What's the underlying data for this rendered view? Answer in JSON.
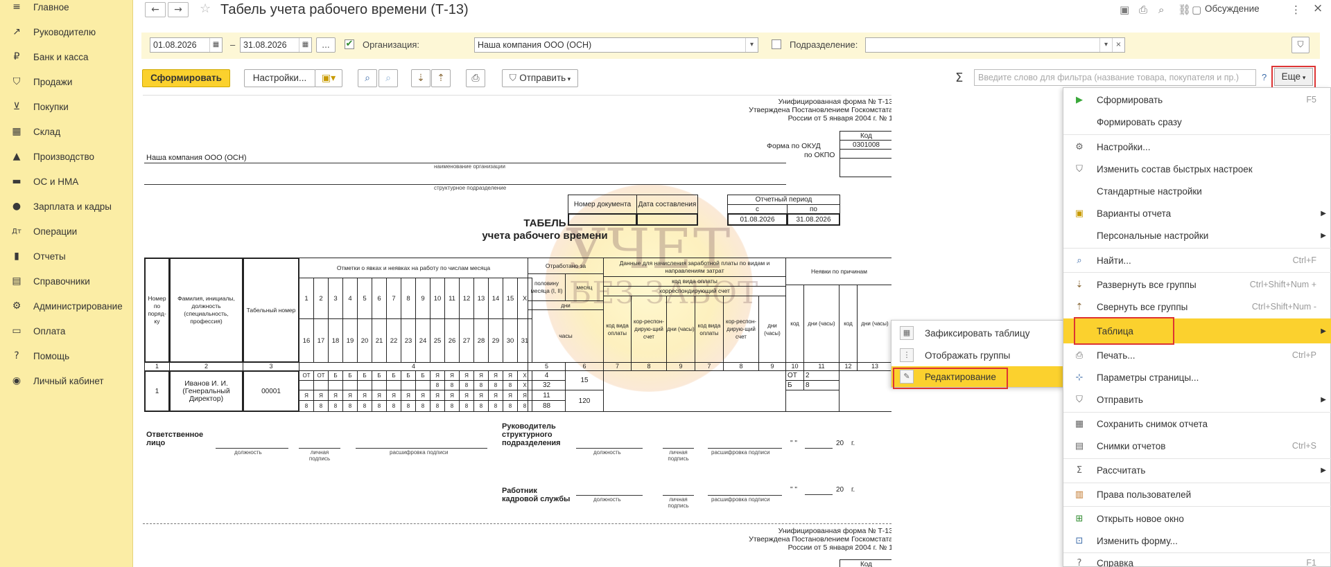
{
  "sidebar": {
    "items": [
      {
        "icon": "≡",
        "label": "Главное"
      },
      {
        "icon": "↗",
        "label": "Руководителю"
      },
      {
        "icon": "₽",
        "label": "Банк и касса"
      },
      {
        "icon": "⛉",
        "label": "Продажи"
      },
      {
        "icon": "⊻",
        "label": "Покупки"
      },
      {
        "icon": "▦",
        "label": "Склад"
      },
      {
        "icon": "▲",
        "label": "Производство"
      },
      {
        "icon": "▬",
        "label": "ОС и НМА"
      },
      {
        "icon": "●",
        "label": "Зарплата и кадры"
      },
      {
        "icon": "Дт",
        "label": "Операции"
      },
      {
        "icon": "▮",
        "label": "Отчеты"
      },
      {
        "icon": "▤",
        "label": "Справочники"
      },
      {
        "icon": "⚙",
        "label": "Администрирование"
      },
      {
        "icon": "▭",
        "label": "Оплата"
      },
      {
        "icon": "?",
        "label": "Помощь"
      },
      {
        "icon": "◉",
        "label": "Личный кабинет"
      }
    ]
  },
  "titlebar": {
    "back": "←",
    "forward": "→",
    "star": "☆",
    "title": "Табель учета рабочего времени (Т-13)",
    "discuss": "Обсуждение",
    "more_dots": "⋮",
    "close": "×"
  },
  "filter": {
    "date_from": "01.08.2026",
    "dash": "–",
    "date_to": "31.08.2026",
    "ellipsis": "...",
    "org_label": "Организация:",
    "org_value": "Наша компания ООО (ОСН)",
    "dept_label": "Подразделение:",
    "dept_value": ""
  },
  "commands": {
    "generate": "Сформировать",
    "settings": "Настройки...",
    "send": "Отправить",
    "sigma": "Σ",
    "search_placeholder": "Введите слово для фильтра (название товара, покупателя и пр.)",
    "help": "?",
    "more": "Еще"
  },
  "report": {
    "unified_form": "Унифицированная форма № Т-13",
    "approved": "Утверждена Постановлением Госкомстата",
    "approved_date": "России от 5 января 2004 г. № 1",
    "kod": "Код",
    "okud_label": "Форма по ОКУД",
    "okud_value": "0301008",
    "okpo_label": "по ОКПО",
    "org_name": "Наша компания ООО (ОСН)",
    "org_caption": "наименование организации",
    "dept_caption": "структурное подразделение",
    "doc_number": "Номер документа",
    "doc_date": "Дата составления",
    "period": "Отчетный период",
    "period_from": "с",
    "period_to": "по",
    "period_from_value": "01.08.2026",
    "period_to_value": "31.08.2026",
    "tabel": "ТАБЕЛЬ",
    "tabel_sub": "учета  рабочего времени",
    "watermark_line1": "УЧЕТ",
    "watermark_line2": "БЕЗ ЗАБОТ",
    "headers": {
      "num": "Номер по поряд-ку",
      "fio": "Фамилия, инициалы, должность (специальность, профессия)",
      "tab_num": "Табельный номер",
      "marks": "Отметки о явках и неявках на работу по числам месяца",
      "worked": "Отработано за",
      "half_month": "половину месяца (I, II)",
      "month": "месяц",
      "days": "дни",
      "hours": "часы",
      "payroll": "Данные для начисления заработной платы по видам и направлениям затрат",
      "pay_code": "код вида оплаты",
      "corr_acc": "корреспондирующий счет",
      "code_pay": "код вида оплаты",
      "corr": "кор-респон-дирую-щий счет",
      "days_hours": "дни (часы)",
      "absence": "Неявки по причинам",
      "code": "код",
      "x": "Х"
    },
    "days_row1": [
      "1",
      "2",
      "3",
      "4",
      "5",
      "6",
      "7",
      "8",
      "9",
      "10",
      "11",
      "12",
      "13",
      "14",
      "15",
      "Х"
    ],
    "days_row2": [
      "16",
      "17",
      "18",
      "19",
      "20",
      "21",
      "22",
      "23",
      "24",
      "25",
      "26",
      "27",
      "28",
      "29",
      "30",
      "31"
    ],
    "col_numbers": [
      "1",
      "2",
      "3",
      "4",
      "5",
      "6",
      "7",
      "8",
      "9",
      "7",
      "8",
      "9",
      "10",
      "11",
      "12",
      "13"
    ],
    "employee": {
      "num": "1",
      "fio": "Иванов И. И. (Генеральный Директор)",
      "tab_num": "00001",
      "row1": [
        "ОТ",
        "ОТ",
        "Б",
        "Б",
        "Б",
        "Б",
        "Б",
        "Б",
        "Б",
        "Я",
        "Я",
        "Я",
        "Я",
        "Я",
        "Я",
        "Х"
      ],
      "row2": [
        "",
        "",
        "",
        "",
        "",
        "",
        "",
        "",
        "",
        "8",
        "8",
        "8",
        "8",
        "8",
        "8",
        "Х"
      ],
      "row3": [
        "Я",
        "Я",
        "Я",
        "Я",
        "Я",
        "Я",
        "Я",
        "Я",
        "Я",
        "Я",
        "Я",
        "Я",
        "Я",
        "Я",
        "Я",
        "Я"
      ],
      "row4": [
        "8",
        "8",
        "8",
        "8",
        "8",
        "8",
        "8",
        "8",
        "8",
        "8",
        "8",
        "8",
        "8",
        "8",
        "8",
        "8"
      ],
      "half_days_1": "4",
      "half_hours_1": "32",
      "half_days_2": "11",
      "half_hours_2": "88",
      "month_days": "15",
      "month_hours": "120",
      "abs1_code": "ОТ",
      "abs1_val": "2",
      "abs2_code": "Б",
      "abs2_val": "8"
    },
    "responsible": "Ответственное лицо",
    "dept_head": "Руководитель структурного подразделения",
    "hr_worker": "Работник кадровой службы",
    "position": "должность",
    "signature": "личная подпись",
    "signature_decode": "расшифровка подписи",
    "date_stub": "\" \"",
    "year_stub": "20",
    "year_suffix": "г."
  },
  "menu": {
    "items": [
      {
        "icon": "▶",
        "label": "Сформировать",
        "shortcut": "F5"
      },
      {
        "icon": "",
        "label": "Формировать сразу",
        "shortcut": ""
      },
      {
        "icon": "⚙",
        "label": "Настройки...",
        "shortcut": ""
      },
      {
        "icon": "⛉",
        "label": "Изменить состав быстрых настроек",
        "shortcut": ""
      },
      {
        "icon": "",
        "label": "Стандартные настройки",
        "shortcut": ""
      },
      {
        "icon": "▣",
        "label": "Варианты отчета",
        "shortcut": ""
      },
      {
        "icon": "",
        "label": "Персональные настройки",
        "shortcut": ""
      },
      {
        "icon": "⌕",
        "label": "Найти...",
        "shortcut": "Ctrl+F"
      },
      {
        "icon": "⇣",
        "label": "Развернуть все группы",
        "shortcut": "Ctrl+Shift+Num +"
      },
      {
        "icon": "⇡",
        "label": "Свернуть все группы",
        "shortcut": "Ctrl+Shift+Num -"
      },
      {
        "icon": "",
        "label": "Таблица",
        "shortcut": ""
      },
      {
        "icon": "⎙",
        "label": "Печать...",
        "shortcut": "Ctrl+P"
      },
      {
        "icon": "⊹",
        "label": "Параметры страницы...",
        "shortcut": ""
      },
      {
        "icon": "⛉",
        "label": "Отправить",
        "shortcut": ""
      },
      {
        "icon": "▦",
        "label": "Сохранить снимок отчета",
        "shortcut": ""
      },
      {
        "icon": "▤",
        "label": "Снимки отчетов",
        "shortcut": "Ctrl+S"
      },
      {
        "icon": "Σ",
        "label": "Рассчитать",
        "shortcut": ""
      },
      {
        "icon": "▥",
        "label": "Права пользователей",
        "shortcut": ""
      },
      {
        "icon": "⊞",
        "label": "Открыть новое окно",
        "shortcut": ""
      },
      {
        "icon": "⊡",
        "label": "Изменить форму...",
        "shortcut": ""
      },
      {
        "icon": "?",
        "label": "Справка",
        "shortcut": "F1"
      }
    ],
    "arrow": "▶"
  },
  "submenu": {
    "items": [
      {
        "icon": "▦",
        "label": "Зафиксировать таблицу"
      },
      {
        "icon": "⋮",
        "label": "Отображать группы"
      },
      {
        "icon": "✎",
        "label": "Редактирование"
      }
    ]
  }
}
